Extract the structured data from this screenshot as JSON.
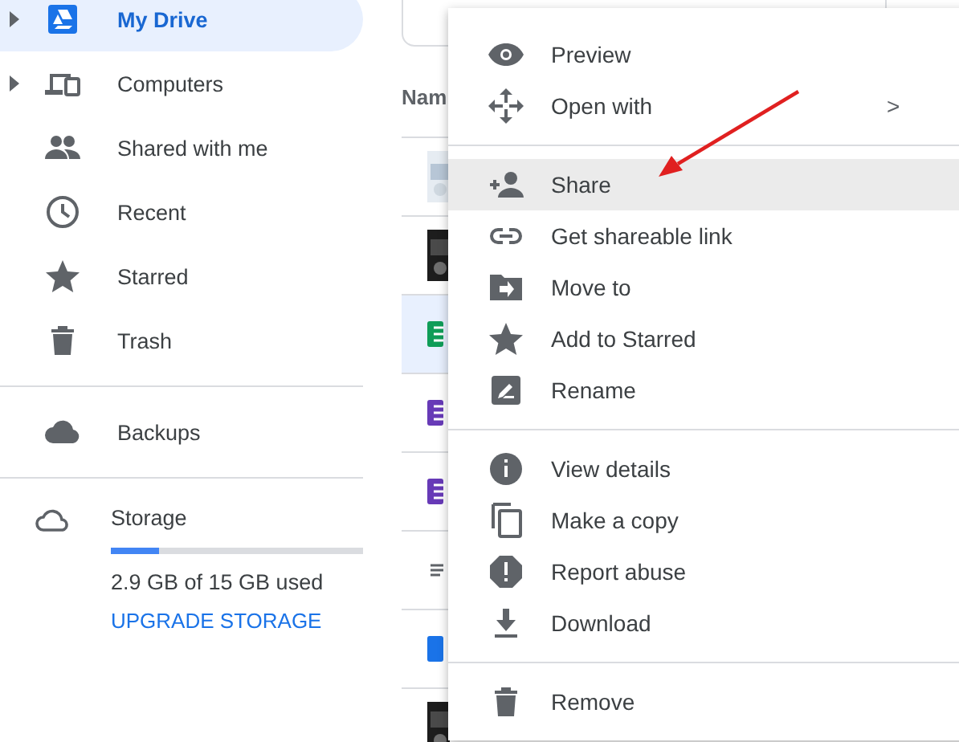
{
  "sidebar": {
    "nav": [
      {
        "label": "My Drive",
        "selected": true,
        "expandable": true
      },
      {
        "label": "Computers",
        "selected": false,
        "expandable": true
      },
      {
        "label": "Shared with me",
        "selected": false,
        "expandable": false
      },
      {
        "label": "Recent",
        "selected": false,
        "expandable": false
      },
      {
        "label": "Starred",
        "selected": false,
        "expandable": false
      },
      {
        "label": "Trash",
        "selected": false,
        "expandable": false
      }
    ],
    "backups": {
      "label": "Backups"
    },
    "storage": {
      "label": "Storage",
      "level": 0.19,
      "usage": "2.9 GB of 15 GB used",
      "upgrade": "UPGRADE STORAGE"
    }
  },
  "file_list": {
    "column_header": "Nam",
    "rows": [
      {
        "kind": "picture",
        "selected": false
      },
      {
        "kind": "picture",
        "selected": false
      },
      {
        "kind": "sheet",
        "selected": true
      },
      {
        "kind": "form",
        "selected": false
      },
      {
        "kind": "form",
        "selected": false
      },
      {
        "kind": "text",
        "selected": false
      },
      {
        "kind": "doc",
        "selected": false
      },
      {
        "kind": "picture",
        "selected": false
      }
    ]
  },
  "context_menu": {
    "sections": [
      [
        {
          "label": "Preview",
          "highlighted": false,
          "submenu": false
        },
        {
          "label": "Open with",
          "highlighted": false,
          "submenu": true,
          "chevron": ">"
        }
      ],
      [
        {
          "label": "Share",
          "highlighted": true,
          "submenu": false
        },
        {
          "label": "Get shareable link",
          "highlighted": false,
          "submenu": false
        },
        {
          "label": "Move to",
          "highlighted": false,
          "submenu": false
        },
        {
          "label": "Add to Starred",
          "highlighted": false,
          "submenu": false
        },
        {
          "label": "Rename",
          "highlighted": false,
          "submenu": false
        }
      ],
      [
        {
          "label": "View details",
          "highlighted": false,
          "submenu": false
        },
        {
          "label": "Make a copy",
          "highlighted": false,
          "submenu": false
        },
        {
          "label": "Report abuse",
          "highlighted": false,
          "submenu": false
        },
        {
          "label": "Download",
          "highlighted": false,
          "submenu": false
        }
      ],
      [
        {
          "label": "Remove",
          "highlighted": false,
          "submenu": false
        }
      ]
    ]
  }
}
